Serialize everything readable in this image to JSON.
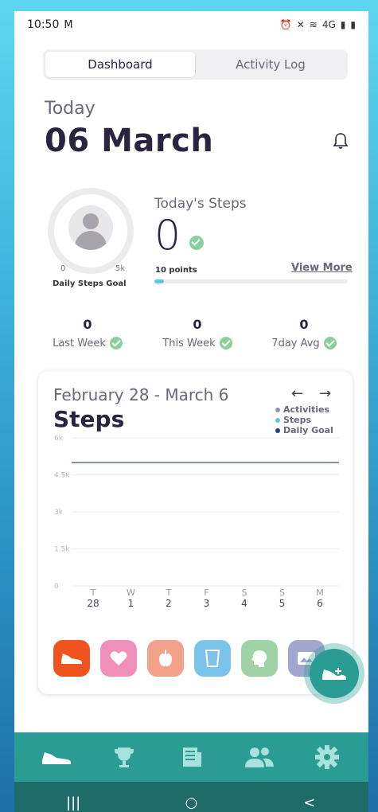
{
  "status": {
    "time": "10:50",
    "mail_icon": "M",
    "network": "4G"
  },
  "tabs": [
    {
      "label": "Dashboard",
      "active": true
    },
    {
      "label": "Activity Log",
      "active": false
    }
  ],
  "header": {
    "today_label": "Today",
    "date": "06 March"
  },
  "goal": {
    "min": "0",
    "max": "5k",
    "label": "Daily Steps Goal"
  },
  "steps": {
    "title": "Today's Steps",
    "value": "0",
    "points": "10 points",
    "view_more": "View More",
    "progress": 0.05
  },
  "stats": [
    {
      "value": "0",
      "label": "Last Week"
    },
    {
      "value": "0",
      "label": "This Week"
    },
    {
      "value": "0",
      "label": "7day Avg"
    }
  ],
  "chart_card": {
    "range": "February 28 - March 6",
    "title": "Steps",
    "prev_arrow": "←",
    "next_arrow": "→",
    "legend": [
      {
        "label": "Activities",
        "color": "#8a93b8"
      },
      {
        "label": "Steps",
        "color": "#5ec7e6"
      },
      {
        "label": "Daily Goal",
        "color": "#2c3f7a"
      }
    ]
  },
  "chart_data": {
    "type": "line",
    "x_days": [
      "T",
      "W",
      "T",
      "F",
      "S",
      "S",
      "M"
    ],
    "x_dates": [
      "28",
      "1",
      "2",
      "3",
      "4",
      "5",
      "6"
    ],
    "ylim": [
      0,
      6000
    ],
    "y_ticks": [
      "0",
      "1.5k",
      "3k",
      "4.5k",
      "6k"
    ],
    "y_tick_values": [
      0,
      1500,
      3000,
      4500,
      6000
    ],
    "series": [
      {
        "name": "Daily Goal",
        "values": [
          5000,
          5000,
          5000,
          5000,
          5000,
          5000,
          5000
        ],
        "color": "#5b6c92"
      },
      {
        "name": "Steps",
        "values": [
          0,
          0,
          0,
          0,
          0,
          0,
          0
        ],
        "color": "#5ec7e6"
      }
    ]
  },
  "activity_icons": [
    {
      "name": "shoe",
      "color": "#f0541e"
    },
    {
      "name": "heart",
      "color": "#f090b8"
    },
    {
      "name": "apple",
      "color": "#f2a28a"
    },
    {
      "name": "cup",
      "color": "#7cc3ea"
    },
    {
      "name": "brain",
      "color": "#9fd2a5"
    },
    {
      "name": "image",
      "color": "#a3a7cf"
    }
  ],
  "colors": {
    "accent": "#2a9c93",
    "check": "#8ccf9f"
  },
  "nav": [
    "shoe-icon",
    "trophy-icon",
    "news-icon",
    "people-icon",
    "gear-icon"
  ],
  "system": {
    "recent": "|||",
    "home": "○",
    "back": "<"
  }
}
